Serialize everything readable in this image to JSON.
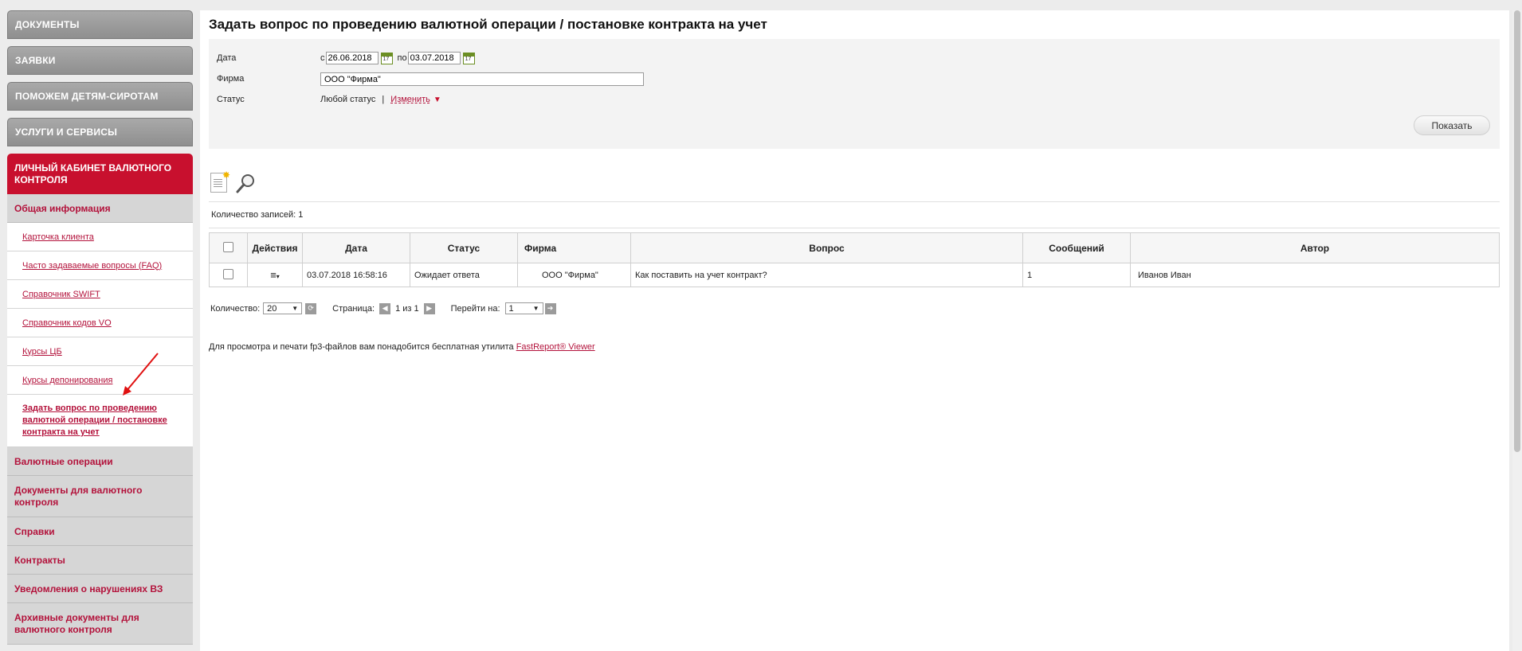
{
  "sidebar": {
    "top_menu": [
      "ДОКУМЕНТЫ",
      "ЗАЯВКИ",
      "ПОМОЖЕМ ДЕТЯМ-СИРОТАМ",
      "УСЛУГИ И СЕРВИСЫ"
    ],
    "active_menu": "ЛИЧНЫЙ КАБИНЕТ ВАЛЮТНОГО КОНТРОЛЯ",
    "general_info": "Общая информация",
    "sub_items": [
      "Карточка клиента",
      "Часто задаваемые вопросы (FAQ)",
      "Справочник SWIFT",
      "Справочник кодов VO",
      "Курсы ЦБ",
      "Курсы депонирования"
    ],
    "current_item": "Задать вопрос по проведению валютной операции / постановке контракта на учет",
    "sections": [
      "Валютные операции",
      "Документы для валютного контроля",
      "Справки",
      "Контракты",
      "Уведомления о нарушениях ВЗ",
      "Архивные документы для валютного контроля"
    ]
  },
  "main": {
    "title": "Задать вопрос по проведению валютной операции / постановке контракта на учет",
    "filter": {
      "date_label": "Дата",
      "from_label": "с",
      "date_from": "26.06.2018",
      "to_label": "по",
      "date_to": "03.07.2018",
      "firm_label": "Фирма",
      "firm_value": "ООО \"Фирма\"",
      "status_label": "Статус",
      "status_value": "Любой статус",
      "separator": "|",
      "change_label": "Изменить",
      "show_button": "Показать"
    },
    "records_count": "Количество записей: 1",
    "table": {
      "headers": [
        "Действия",
        "Дата",
        "Статус",
        "Фирма",
        "Вопрос",
        "Сообщений",
        "Автор"
      ],
      "rows": [
        {
          "date": "03.07.2018 16:58:16",
          "status": "Ожидает ответа",
          "firm": "ООО \"Фирма\"",
          "question": "Как поставить на учет контракт?",
          "messages": "1",
          "author": "Иванов Иван"
        }
      ]
    },
    "pager": {
      "count_label": "Количество:",
      "count_value": "20",
      "page_label": "Страница:",
      "page_info": "1 из 1",
      "goto_label": "Перейти на:",
      "goto_value": "1"
    },
    "footer": {
      "text": "Для просмотра и печати fp3-файлов вам понадобится бесплатная утилита",
      "link": "FastReport® Viewer"
    }
  },
  "colors": {
    "accent_red": "#c8102e",
    "link_red": "#b3123b",
    "menu_gray": "#999999"
  }
}
